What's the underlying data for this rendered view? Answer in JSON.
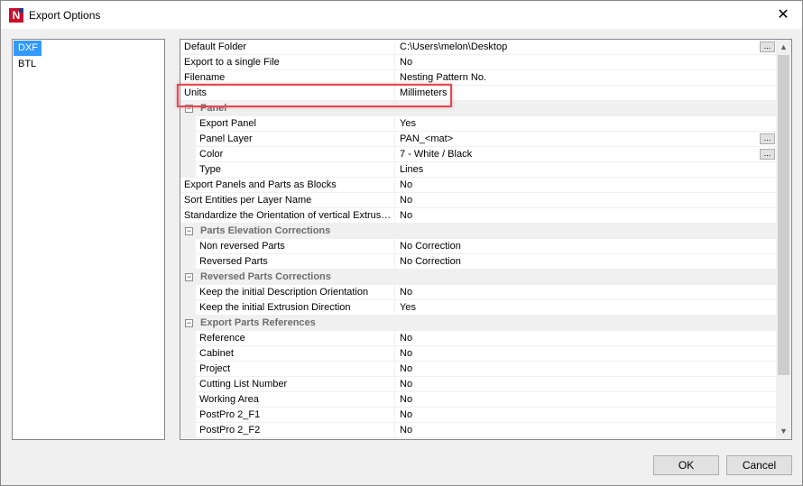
{
  "window": {
    "title": "Export Options",
    "icon_letter": "N",
    "close_glyph": "✕"
  },
  "left_list": {
    "items": [
      {
        "label": "DXF",
        "selected": true
      },
      {
        "label": "BTL",
        "selected": false
      }
    ]
  },
  "properties": {
    "rows": [
      {
        "type": "prop",
        "name": "Default Folder",
        "value": "C:\\Users\\melon\\Desktop",
        "ellipsis": true,
        "indent": false
      },
      {
        "type": "prop",
        "name": "Export to a single File",
        "value": "No",
        "indent": false
      },
      {
        "type": "prop",
        "name": "Filename",
        "value": "Nesting Pattern No.",
        "indent": false
      },
      {
        "type": "prop",
        "name": "Units",
        "value": "Millimeters",
        "indent": false
      },
      {
        "type": "cat",
        "name": "Panel"
      },
      {
        "type": "prop",
        "name": "Export Panel",
        "value": "Yes",
        "indent": true
      },
      {
        "type": "prop",
        "name": "Panel Layer",
        "value": "PAN_<mat>",
        "ellipsis": true,
        "indent": true
      },
      {
        "type": "prop",
        "name": "Color",
        "value": "7 - White / Black",
        "ellipsis": true,
        "indent": true
      },
      {
        "type": "prop",
        "name": "Type",
        "value": "Lines",
        "indent": true
      },
      {
        "type": "prop",
        "name": "Export Panels and Parts as Blocks",
        "value": "No",
        "indent": false
      },
      {
        "type": "prop",
        "name": "Sort Entities per Layer Name",
        "value": "No",
        "indent": false
      },
      {
        "type": "prop",
        "name": "Standardize the Orientation of vertical Extrus…",
        "value": "No",
        "indent": false
      },
      {
        "type": "cat",
        "name": "Parts Elevation Corrections"
      },
      {
        "type": "prop",
        "name": "Non reversed Parts",
        "value": "No Correction",
        "indent": true
      },
      {
        "type": "prop",
        "name": "Reversed Parts",
        "value": "No Correction",
        "indent": true
      },
      {
        "type": "cat",
        "name": "Reversed Parts Corrections"
      },
      {
        "type": "prop",
        "name": "Keep the initial Description Orientation",
        "value": "No",
        "indent": true
      },
      {
        "type": "prop",
        "name": "Keep the initial Extrusion Direction",
        "value": "Yes",
        "indent": true
      },
      {
        "type": "cat",
        "name": "Export Parts References"
      },
      {
        "type": "prop",
        "name": "Reference",
        "value": "No",
        "indent": true
      },
      {
        "type": "prop",
        "name": "Cabinet",
        "value": "No",
        "indent": true
      },
      {
        "type": "prop",
        "name": "Project",
        "value": "No",
        "indent": true
      },
      {
        "type": "prop",
        "name": "Cutting List Number",
        "value": "No",
        "indent": true
      },
      {
        "type": "prop",
        "name": "Working Area",
        "value": "No",
        "indent": true
      },
      {
        "type": "prop",
        "name": "PostPro 2_F1",
        "value": "No",
        "indent": true
      },
      {
        "type": "prop",
        "name": "PostPro 2_F2",
        "value": "No",
        "indent": true
      }
    ],
    "ellipsis_label": "...",
    "expander_glyph": "−"
  },
  "scrollbar": {
    "up_glyph": "▲",
    "down_glyph": "▼"
  },
  "buttons": {
    "ok": "OK",
    "cancel": "Cancel"
  },
  "colors": {
    "selection": "#3399ff",
    "highlight": "#e8474f",
    "app_red": "#c8102e",
    "app_blue": "#1a3d8f"
  }
}
